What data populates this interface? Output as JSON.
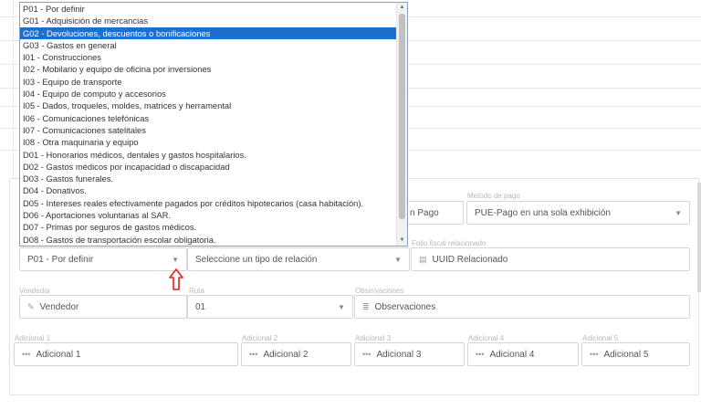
{
  "dropdown": {
    "selected_index": 2,
    "options": [
      "P01 - Por definir",
      "G01 - Adquisición de mercancias",
      "G02 - Devoluciones, descuentos o bonificaciones",
      "G03 - Gastos en general",
      "I01 - Construcciones",
      "I02 - Mobilario y equipo de oficina por inversiones",
      "I03 - Equipo de transporte",
      "I04 - Equipo de computo y accesorios",
      "I05 - Dados, troqueles, moldes, matrices y herramental",
      "I06 - Comunicaciones telefónicas",
      "I07 - Comunicaciones satelitales",
      "I08 - Otra maquinaria y equipo",
      "D01 - Honorarios médicos, dentales y gastos hospitalarios.",
      "D02 - Gastos médicos por incapacidad o discapacidad",
      "D03 - Gastos funerales.",
      "D04 - Donativos.",
      "D05 - Intereses reales efectivamente pagados por créditos hipotecarios (casa habitación).",
      "D06 - Aportaciones voluntarias al SAR.",
      "D07 - Primas por seguros de gastos médicos.",
      "D08 - Gastos de transportación escolar obligatoria."
    ]
  },
  "form": {
    "forma_pago_partial": "n Pago",
    "metodo_pago_label": "Metodo de pago",
    "metodo_pago_value": "PUE-Pago en una sola exhibición",
    "folio_label": "Folio fiscal relacionado",
    "uso_cfdi_value": "P01 - Por definir",
    "tipo_relacion_value": "Seleccione un tipo de relación",
    "uuid_placeholder": "UUID Relacionado",
    "vendedor_label": "Vendedor",
    "vendedor_placeholder": "Vendedor",
    "ruta_label": "Ruta",
    "ruta_value": "01",
    "observaciones_label": "Observaciones",
    "observaciones_placeholder": "Observaciones",
    "adicional1_label": "Adicional 1",
    "adicional1_placeholder": "Adicional 1",
    "adicional2_label": "Adicional 2",
    "adicional2_placeholder": "Adicional 2",
    "adicional3_label": "Adicional 3",
    "adicional3_placeholder": "Adicional 3",
    "adicional4_label": "Adicional 4",
    "adicional4_placeholder": "Adicional 4",
    "adicional5_label": "Adicional 5",
    "adicional5_placeholder": "Adicional 5"
  },
  "icons": {
    "caret": "▼",
    "scroll_up": "▲",
    "scroll_down": "▼",
    "edit": "✎",
    "file": "▤",
    "list": "≣",
    "dots": "•••"
  },
  "colors": {
    "selected_option": "#1e6fcc",
    "annotation_arrow": "#e02020"
  }
}
